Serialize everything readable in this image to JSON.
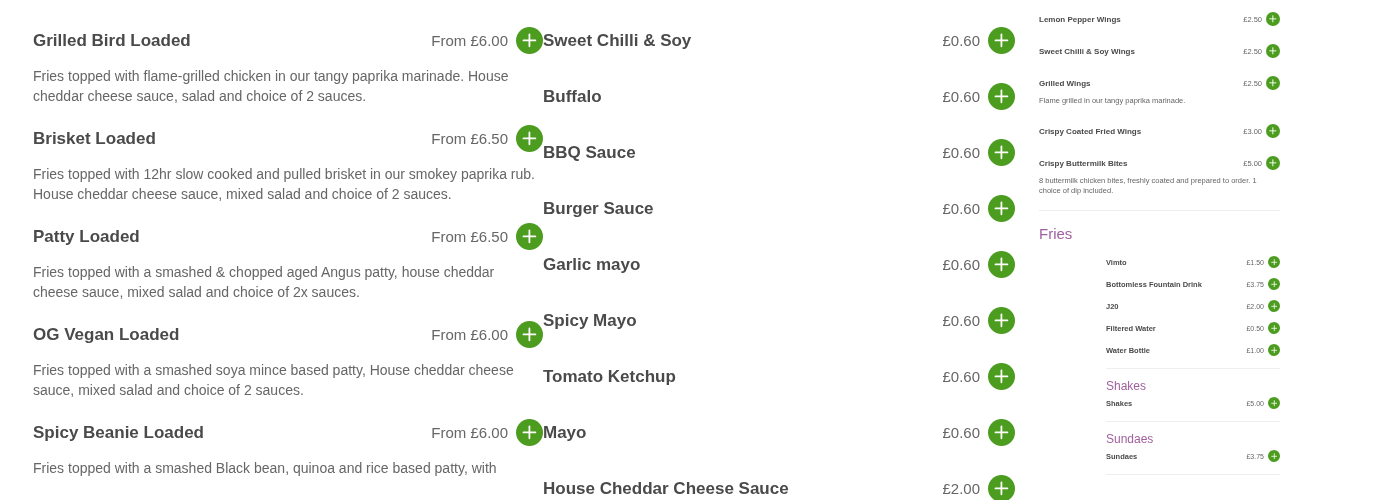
{
  "loaded_items": [
    {
      "name": "Grilled Bird Loaded",
      "price": "From £6.00",
      "description": "Fries topped with flame-grilled chicken in our tangy paprika marinade. House cheddar cheese sauce, salad and choice of 2 sauces."
    },
    {
      "name": "Brisket Loaded",
      "price": "From £6.50",
      "description": "Fries topped with 12hr slow cooked and pulled brisket in our smokey paprika rub. House cheddar cheese sauce, mixed salad and choice of 2 sauces."
    },
    {
      "name": "Patty Loaded",
      "price": "From £6.50",
      "description": "Fries topped with a smashed & chopped aged Angus patty, house cheddar cheese sauce, mixed salad and choice of 2x sauces."
    },
    {
      "name": "OG Vegan Loaded",
      "price": "From £6.00",
      "description": "Fries topped with a smashed soya mince based patty, House cheddar cheese sauce, mixed salad and choice of 2 sauces."
    },
    {
      "name": "Spicy Beanie Loaded",
      "price": "From £6.00",
      "description": "Fries topped with a smashed Black bean, quinoa and rice based patty, with"
    }
  ],
  "sauce_items": [
    {
      "name": "Sweet Chilli & Soy",
      "price": "£0.60"
    },
    {
      "name": "Buffalo",
      "price": "£0.60"
    },
    {
      "name": "BBQ Sauce",
      "price": "£0.60"
    },
    {
      "name": "Burger Sauce",
      "price": "£0.60"
    },
    {
      "name": "Garlic mayo",
      "price": "£0.60"
    },
    {
      "name": "Spicy Mayo",
      "price": "£0.60"
    },
    {
      "name": "Tomato Ketchup",
      "price": "£0.60"
    },
    {
      "name": "Mayo",
      "price": "£0.60"
    },
    {
      "name": "House Cheddar Cheese Sauce",
      "price": "£2.00"
    }
  ],
  "preview": {
    "items": [
      {
        "name": "Lemon Pepper Wings",
        "price": "£2.50"
      },
      {
        "name": "Sweet Chilli & Soy Wings",
        "price": "£2.50"
      },
      {
        "name": "Grilled Wings",
        "price": "£2.50",
        "description": "Flame grilled in our tangy paprika marinade."
      },
      {
        "name": "Crispy Coated Fried Wings",
        "price": "£3.00"
      },
      {
        "name": "Crispy Buttermilk Bites",
        "price": "£5.00",
        "description": "8 buttermilk chicken bites, freshly coated and prepared to order. 1 choice of dip included."
      }
    ],
    "sections": [
      {
        "kind": "main",
        "heading": "Fries",
        "items": [
          {
            "name": "Vimto",
            "price": "£1.50"
          },
          {
            "name": "Bottomless Fountain Drink",
            "price": "£3.75"
          },
          {
            "name": "J20",
            "price": "£2.00"
          },
          {
            "name": "Filtered Water",
            "price": "£0.50"
          },
          {
            "name": "Water Bottle",
            "price": "£1.00"
          }
        ]
      },
      {
        "kind": "sub",
        "heading": "Shakes",
        "items": [
          {
            "name": "Shakes",
            "price": "£5.00"
          }
        ]
      },
      {
        "kind": "sub",
        "heading": "Sundaes",
        "items": [
          {
            "name": "Sundaes",
            "price": "£3.75"
          }
        ]
      }
    ]
  }
}
